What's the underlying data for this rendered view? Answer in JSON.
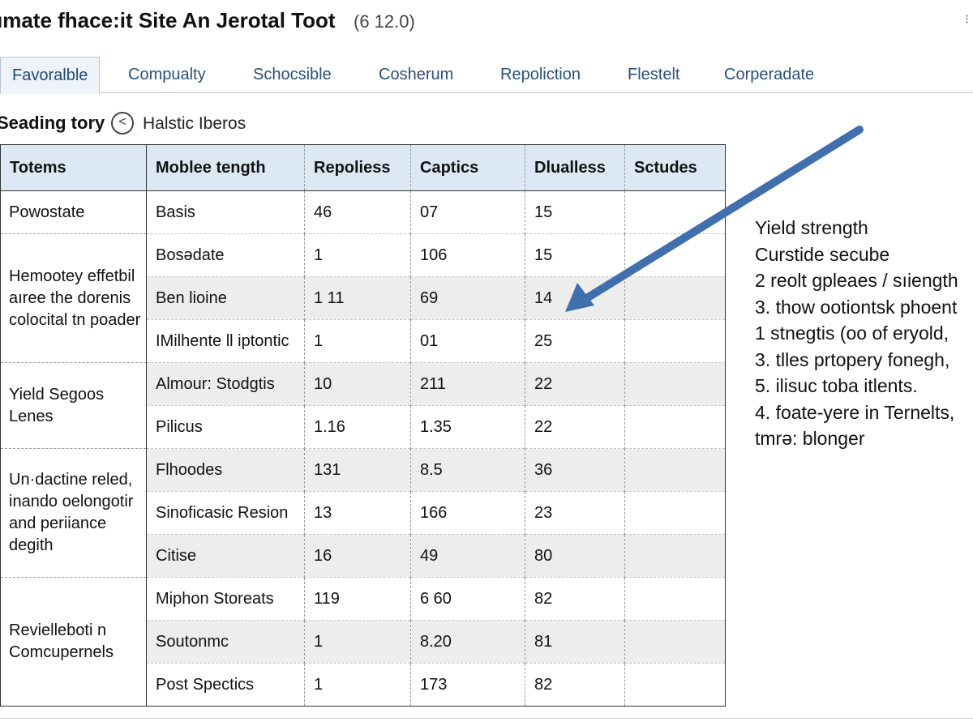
{
  "window": {
    "title": "ımate fhace:it Site An Jerotal Toot",
    "version": "(6 12.0)"
  },
  "tabs": [
    {
      "label": "Favoralble",
      "active": true
    },
    {
      "label": "Compualty",
      "active": false
    },
    {
      "label": "Schocsible",
      "active": false
    },
    {
      "label": "Cosherum",
      "active": false
    },
    {
      "label": "Repoliction",
      "active": false
    },
    {
      "label": "Flestelt",
      "active": false
    },
    {
      "label": "Corperadate",
      "active": false
    }
  ],
  "section": {
    "title": "Seading tory",
    "back_icon": "chevron-left-icon",
    "subtitle": "Halstic Iberos"
  },
  "table": {
    "headers": [
      "Totems",
      "Moblee tength",
      "Repoliess",
      "Captics",
      "Dlualless",
      "Sctudes"
    ],
    "groups": [
      {
        "label": "Powostate",
        "rows": [
          [
            "Basis",
            "46",
            "07",
            "15",
            ""
          ]
        ]
      },
      {
        "label": "Hemootey effetbil aıree the dorenis colocital tn poader",
        "rows": [
          [
            "Bosədate",
            "1",
            "106",
            "15",
            ""
          ],
          [
            "Ben lioine",
            "1 11",
            "69",
            "14",
            ""
          ],
          [
            "IMilhente ll iptontic",
            "1",
            "01",
            "25",
            ""
          ]
        ]
      },
      {
        "label": "Yield Segoos Lenes",
        "rows": [
          [
            "Almour: Stodgtis",
            "10",
            "211",
            "22",
            ""
          ],
          [
            "Pilicus",
            "1.16",
            "1.35",
            "22",
            ""
          ]
        ]
      },
      {
        "label": "Un·dactine reled, inando oelongotir and periiance degith",
        "rows": [
          [
            "Flhoodes",
            "131",
            "8.5",
            "36",
            ""
          ],
          [
            "Sinoficasic Resion",
            "13",
            "166",
            "23",
            ""
          ],
          [
            "Citise",
            "16",
            "49",
            "80",
            ""
          ]
        ]
      },
      {
        "label": "Revielleboti n Comcupernels",
        "rows": [
          [
            "Miphon Storeats",
            "119",
            "6 60",
            "82",
            ""
          ],
          [
            "Soutonmc",
            "1",
            "8.20",
            "81",
            ""
          ],
          [
            "Post Spectics",
            "1",
            "173",
            "82",
            ""
          ]
        ]
      }
    ]
  },
  "notes": [
    "Yield strength",
    "Curstide secube",
    "2 reolt gpleaes / sıiength",
    "3. thow ootiontsk phoent",
    "1 stnegtis (oo of eryold,",
    "3. tlles prtopery fonegh,",
    "5. ilisuc toba itlents.",
    "4. foate-yere in Ternelts,",
    "tmrə: blonger"
  ],
  "colors": {
    "header_bg": "#dce9f5",
    "tab_text": "#2b4f7a",
    "arrow": "#3f70ad",
    "row_shade": "#ededed"
  },
  "annotation": {
    "icon": "arrow-pointer-icon"
  }
}
